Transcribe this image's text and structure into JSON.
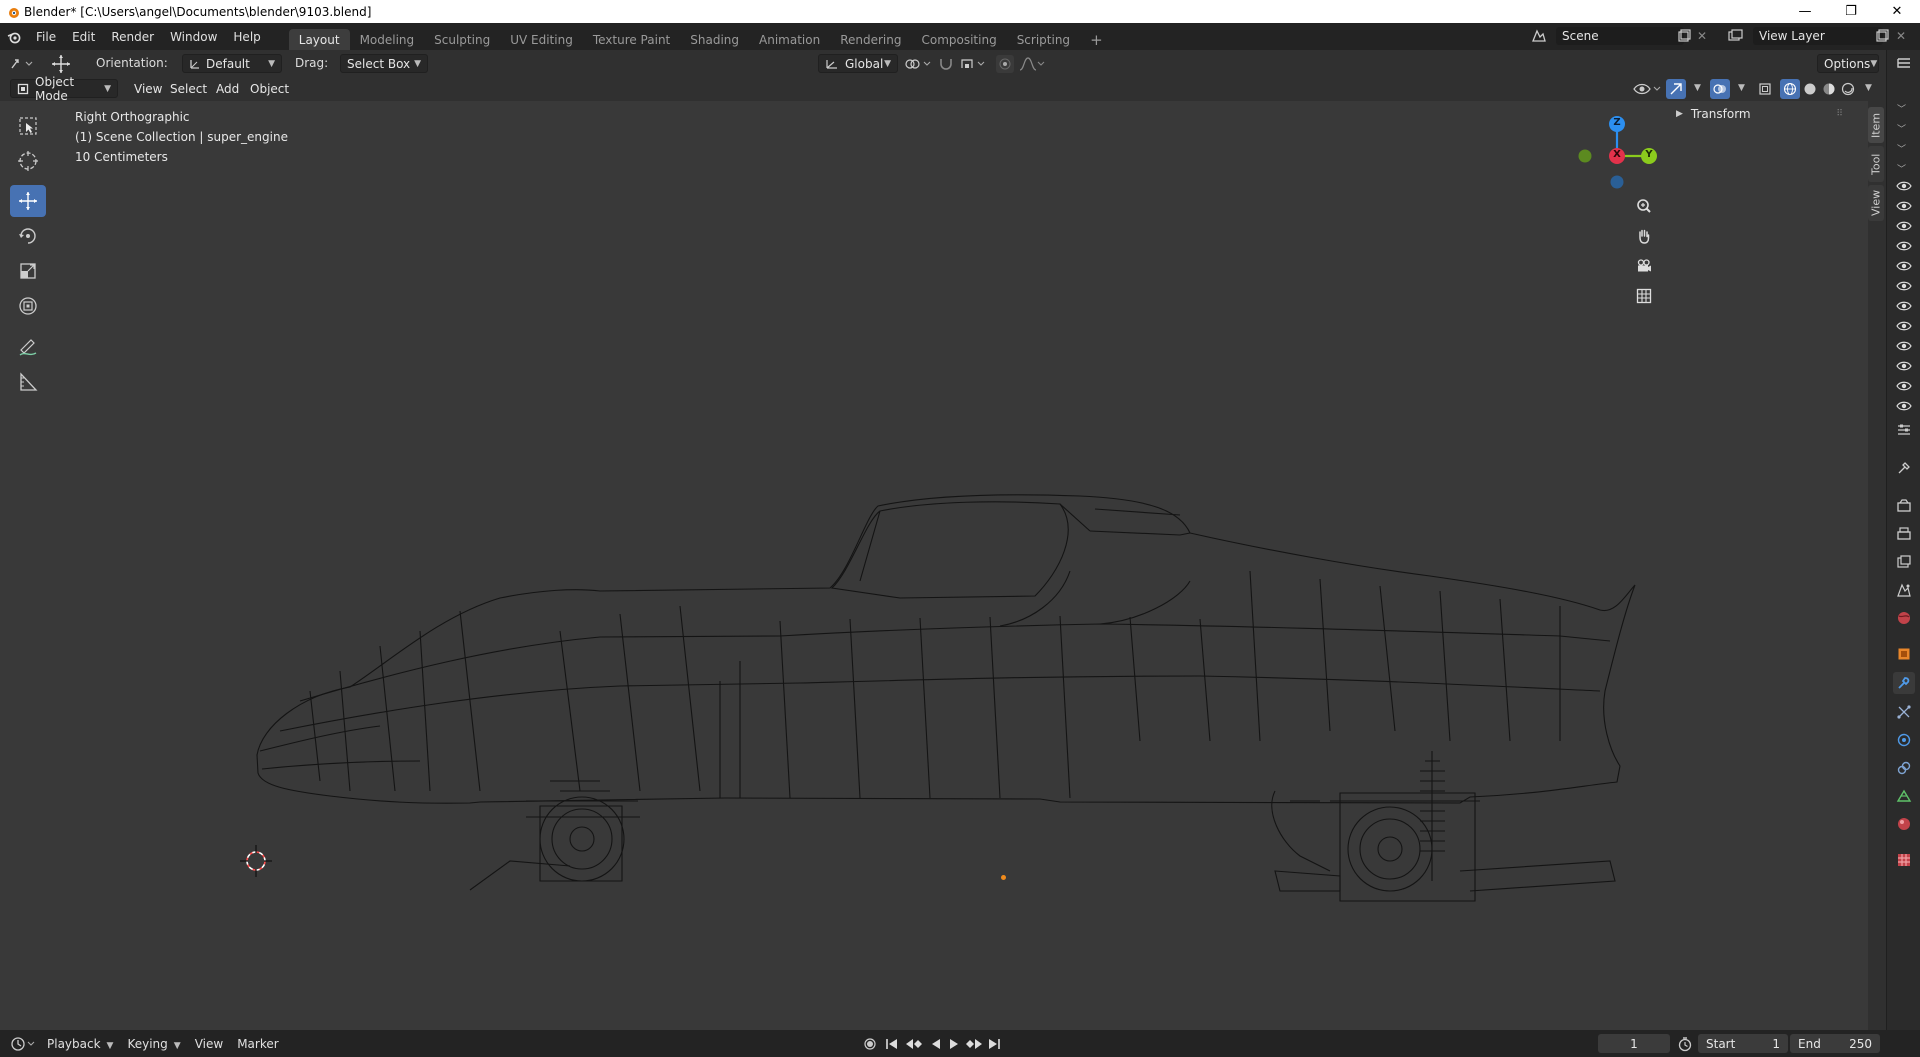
{
  "window": {
    "title": "Blender* [C:\\Users\\angel\\Documents\\blender\\9103.blend]",
    "minimize": "—",
    "restore": "❐",
    "close": "✕"
  },
  "menu": [
    "File",
    "Edit",
    "Render",
    "Window",
    "Help"
  ],
  "workspaces": [
    "Layout",
    "Modeling",
    "Sculpting",
    "UV Editing",
    "Texture Paint",
    "Shading",
    "Animation",
    "Rendering",
    "Compositing",
    "Scripting"
  ],
  "workspace_add": "+",
  "scene": {
    "name": "Scene",
    "view_layer": "View Layer"
  },
  "tool_header": {
    "orientation_label": "Orientation:",
    "orientation_value": "Default",
    "drag_label": "Drag:",
    "drag_value": "Select Box",
    "transform_orientation": "Global",
    "options": "Options"
  },
  "viewport_header": {
    "mode": "Object Mode",
    "items": [
      "View",
      "Select",
      "Add",
      "Object"
    ]
  },
  "viewport_overlay": {
    "view_name": "Right Orthographic",
    "collection": "(1) Scene Collection | super_engine",
    "scale": "10 Centimeters"
  },
  "gizmo": {
    "z": "Z",
    "y": "Y",
    "x": "X"
  },
  "sidebar": {
    "panel": "Transform",
    "tabs": [
      "Item",
      "Tool",
      "View"
    ]
  },
  "timeline": {
    "items": [
      "Playback",
      "Keying",
      "View",
      "Marker"
    ],
    "current_frame": "1",
    "start_label": "Start",
    "start_value": "1",
    "end_label": "End",
    "end_value": "250"
  },
  "colors": {
    "accent": "#4772b3",
    "axis_x": "#e2324b",
    "axis_y": "#8bcb1d",
    "axis_z": "#2c8ff0"
  }
}
